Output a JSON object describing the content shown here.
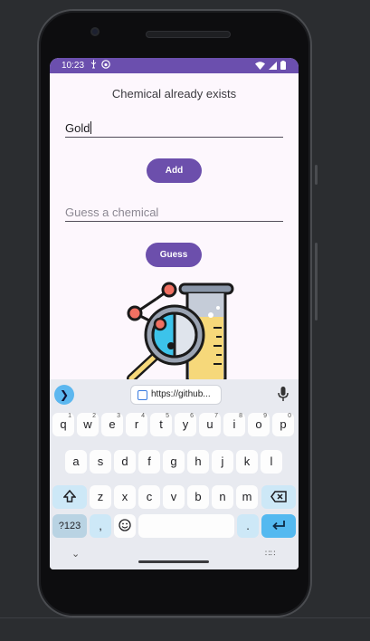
{
  "status_bar": {
    "time": "10:23"
  },
  "app": {
    "message": "Chemical already exists",
    "chemical_input": {
      "value": "Gold"
    },
    "add_button_label": "Add",
    "guess_input": {
      "placeholder": "Guess a chemical"
    },
    "guess_button_label": "Guess"
  },
  "keyboard": {
    "clipboard_suggestion": "https://github...",
    "row1": [
      {
        "label": "q",
        "hint": "1"
      },
      {
        "label": "w",
        "hint": "2"
      },
      {
        "label": "e",
        "hint": "3"
      },
      {
        "label": "r",
        "hint": "4"
      },
      {
        "label": "t",
        "hint": "5"
      },
      {
        "label": "y",
        "hint": "6"
      },
      {
        "label": "u",
        "hint": "7"
      },
      {
        "label": "i",
        "hint": "8"
      },
      {
        "label": "o",
        "hint": "9"
      },
      {
        "label": "p",
        "hint": "0"
      }
    ],
    "row2": [
      "a",
      "s",
      "d",
      "f",
      "g",
      "h",
      "j",
      "k",
      "l"
    ],
    "row3": [
      "z",
      "x",
      "c",
      "v",
      "b",
      "n",
      "m"
    ],
    "symbols_label": "?123",
    "comma_label": ",",
    "period_label": "."
  }
}
